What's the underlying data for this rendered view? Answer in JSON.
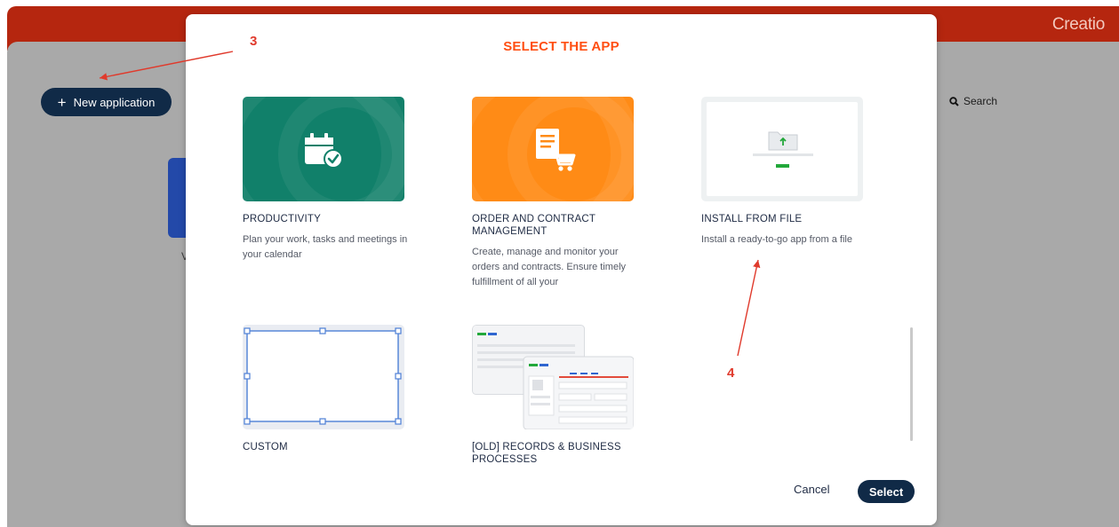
{
  "brand": "Creatio",
  "background": {
    "new_app_button": "New application",
    "search_label": "Search"
  },
  "modal": {
    "title": "SELECT THE APP",
    "cards": [
      {
        "title": "PRODUCTIVITY",
        "desc": "Plan your work, tasks and meetings in your calendar"
      },
      {
        "title": "ORDER AND CONTRACT MANAGEMENT",
        "desc": "Create, manage and monitor your orders and contracts. Ensure timely fulfillment of all your"
      },
      {
        "title": "INSTALL FROM FILE",
        "desc": "Install a ready-to-go app from a file"
      },
      {
        "title": "CUSTOM",
        "desc": ""
      },
      {
        "title": "[OLD] RECORDS & BUSINESS PROCESSES",
        "desc": ""
      }
    ],
    "cancel_label": "Cancel",
    "select_label": "Select"
  },
  "annotations": [
    "3",
    "4"
  ],
  "colors": {
    "accent": "#ff4f13",
    "topbar": "#b5260f",
    "primary_button": "#102a47",
    "productivity": "#11806a",
    "order": "#ff8b16",
    "annotation": "#e03a2c"
  }
}
